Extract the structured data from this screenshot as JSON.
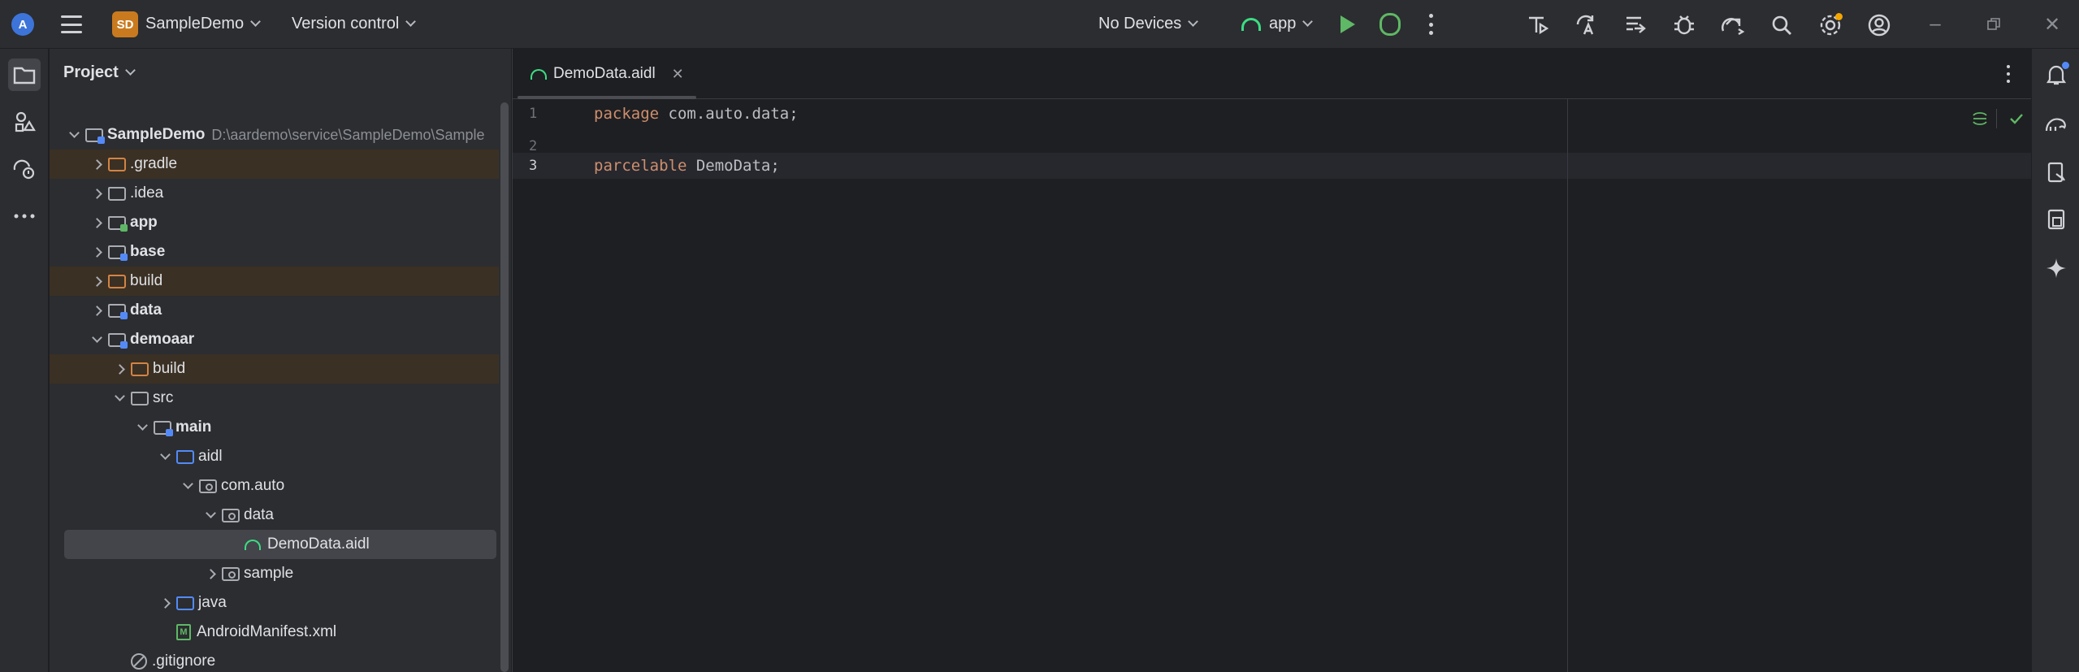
{
  "titlebar": {
    "project_badge": "SD",
    "project_name": "SampleDemo",
    "version_control": "Version control",
    "devices": "No Devices",
    "run_config": "app"
  },
  "project_panel": {
    "title": "Project",
    "tree": [
      {
        "label": "SampleDemo",
        "path": "D:\\aardemo\\service\\SampleDemo\\Sample",
        "depth": 0,
        "expanded": true,
        "icon": "module-folder",
        "bold": true
      },
      {
        "label": ".gradle",
        "depth": 1,
        "expanded": false,
        "icon": "excluded-folder",
        "highlight": true
      },
      {
        "label": ".idea",
        "depth": 1,
        "expanded": false,
        "icon": "folder"
      },
      {
        "label": "app",
        "depth": 1,
        "expanded": false,
        "icon": "app-module-folder",
        "bold": true
      },
      {
        "label": "base",
        "depth": 1,
        "expanded": false,
        "icon": "module-folder",
        "bold": true
      },
      {
        "label": "build",
        "depth": 1,
        "expanded": false,
        "icon": "excluded-folder",
        "highlight": true
      },
      {
        "label": "data",
        "depth": 1,
        "expanded": false,
        "icon": "module-folder",
        "bold": true
      },
      {
        "label": "demoaar",
        "depth": 1,
        "expanded": true,
        "icon": "module-folder",
        "bold": true
      },
      {
        "label": "build",
        "depth": 2,
        "expanded": false,
        "icon": "excluded-folder",
        "highlight": true
      },
      {
        "label": "src",
        "depth": 2,
        "expanded": true,
        "icon": "folder"
      },
      {
        "label": "main",
        "depth": 3,
        "expanded": true,
        "icon": "module-folder",
        "bold": true
      },
      {
        "label": "aidl",
        "depth": 4,
        "expanded": true,
        "icon": "source-folder"
      },
      {
        "label": "com.auto",
        "depth": 5,
        "expanded": true,
        "icon": "package-folder"
      },
      {
        "label": "data",
        "depth": 6,
        "expanded": true,
        "icon": "package-folder"
      },
      {
        "label": "DemoData.aidl",
        "depth": 7,
        "icon": "aidl-file",
        "selected": true
      },
      {
        "label": "sample",
        "depth": 6,
        "expanded": false,
        "icon": "package-folder"
      },
      {
        "label": "java",
        "depth": 4,
        "expanded": false,
        "icon": "source-folder"
      },
      {
        "label": "AndroidManifest.xml",
        "depth": 4,
        "icon": "manifest-file"
      },
      {
        "label": ".gitignore",
        "depth": 2,
        "icon": "ignore-file"
      }
    ]
  },
  "editor": {
    "tab_label": "DemoData.aidl",
    "lines": [
      {
        "num": "1",
        "keyword": "package",
        "rest": " com.auto.data;"
      },
      {
        "num": "2",
        "keyword": "",
        "rest": ""
      },
      {
        "num": "3",
        "keyword": "parcelable",
        "rest": " DemoData;"
      }
    ]
  },
  "colors": {
    "accent_green": "#5fb865",
    "android_green": "#3ddc84",
    "keyword": "#cf8e6d",
    "excluded_highlight": "#3b3024"
  }
}
